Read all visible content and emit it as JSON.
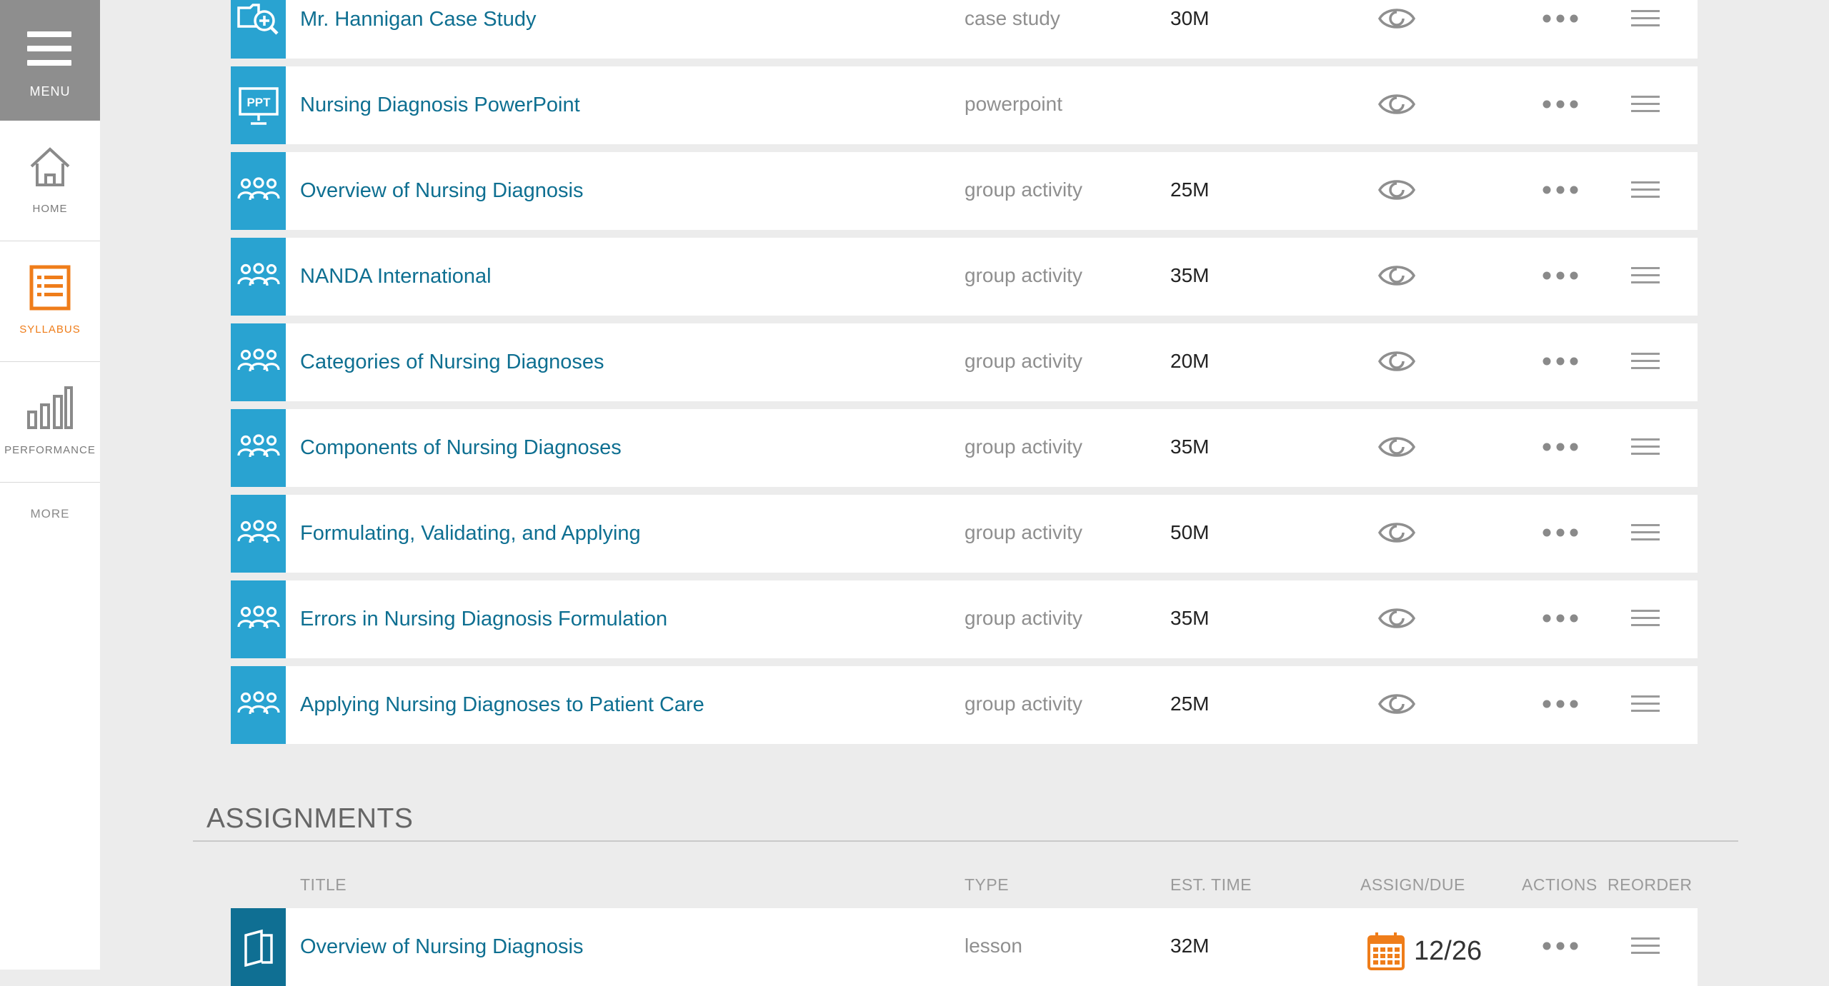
{
  "sidebar": {
    "menu_label": "MENU",
    "items": [
      {
        "label": "HOME"
      },
      {
        "label": "SYLLABUS"
      },
      {
        "label": "PERFORMANCE"
      }
    ],
    "more_label": "MORE"
  },
  "activities": [
    {
      "title": "Mr. Hannigan Case Study",
      "type": "case study",
      "time": "30M",
      "icon": "case-study-icon"
    },
    {
      "title": "Nursing Diagnosis PowerPoint",
      "type": "powerpoint",
      "time": "",
      "icon": "powerpoint-icon",
      "icon_text": "PPT"
    },
    {
      "title": "Overview of Nursing Diagnosis",
      "type": "group activity",
      "time": "25M",
      "icon": "group-icon"
    },
    {
      "title": "NANDA International",
      "type": "group activity",
      "time": "35M",
      "icon": "group-icon"
    },
    {
      "title": "Categories of Nursing Diagnoses",
      "type": "group activity",
      "time": "20M",
      "icon": "group-icon"
    },
    {
      "title": "Components of Nursing Diagnoses",
      "type": "group activity",
      "time": "35M",
      "icon": "group-icon"
    },
    {
      "title": "Formulating, Validating, and Applying",
      "type": "group activity",
      "time": "50M",
      "icon": "group-icon"
    },
    {
      "title": "Errors in Nursing Diagnosis Formulation",
      "type": "group activity",
      "time": "35M",
      "icon": "group-icon"
    },
    {
      "title": "Applying Nursing Diagnoses to Patient Care",
      "type": "group activity",
      "time": "25M",
      "icon": "group-icon"
    }
  ],
  "assignments": {
    "heading": "ASSIGNMENTS",
    "columns": {
      "title": "TITLE",
      "type": "TYPE",
      "est_time": "EST. TIME",
      "assign_due": "ASSIGN/DUE",
      "actions": "ACTIONS",
      "reorder": "REORDER"
    },
    "rows": [
      {
        "title": "Overview of Nursing Diagnosis",
        "type": "lesson",
        "time": "32M",
        "due": "12/26",
        "icon": "lesson-icon"
      }
    ]
  },
  "colors": {
    "tile": "#29a3d1",
    "tile_dark": "#0f6f93",
    "link": "#0e6f91",
    "accent": "#ef7d1a",
    "menu_bg": "#8e8e8e"
  }
}
